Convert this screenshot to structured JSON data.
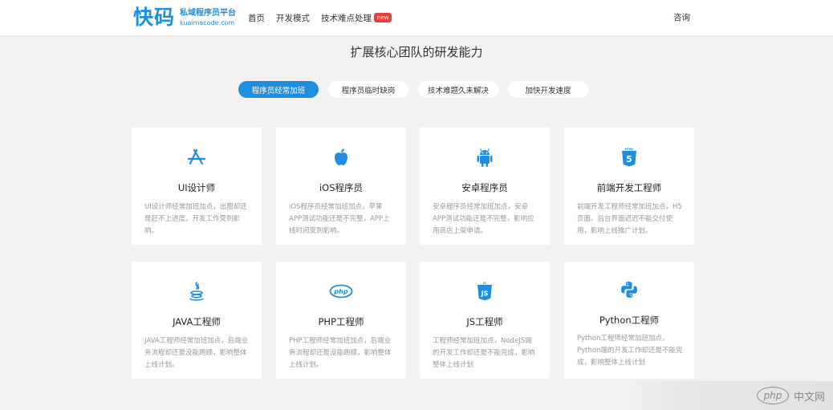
{
  "header": {
    "logo_main": "快码",
    "logo_slogan": "私域程序员平台",
    "logo_domain": "kuaimacode.com",
    "nav": [
      {
        "label": "首页"
      },
      {
        "label": "开发模式"
      },
      {
        "label": "技术难点处理",
        "badge": "new"
      }
    ],
    "consult": "咨询"
  },
  "section_title": "扩展核心团队的研发能力",
  "tabs": [
    {
      "label": "程序员经常加班",
      "active": true
    },
    {
      "label": "程序员临时缺岗",
      "active": false
    },
    {
      "label": "技术难题久未解决",
      "active": false
    },
    {
      "label": "加快开发速度",
      "active": false
    }
  ],
  "cards": [
    {
      "icon": "app-store-icon",
      "title": "UI设计师",
      "desc": "UI设计师经常加班加点，出图却还是赶不上进度，开发工作受到影响。"
    },
    {
      "icon": "apple-icon",
      "title": "iOS程序员",
      "desc": "iOS程序员经常加班加点，苹果APP测试功能还是不完整，APP上线时间受到影响。"
    },
    {
      "icon": "android-icon",
      "title": "安卓程序员",
      "desc": "安卓程序员经常加班加点，安卓APP测试功能还是不完整，影响应用商店上架申请。"
    },
    {
      "icon": "html5-icon",
      "title": "前端开发工程师",
      "desc": "前端开发工程师经常加班加点，H5页面、后台界面迟迟不能交付使用，影响上线推广计划。"
    },
    {
      "icon": "java-icon",
      "title": "JAVA工程师",
      "desc": "JAVA工程师经常加班加点，后端业务流程却还是没能跑顺，影响整体上线计划。"
    },
    {
      "icon": "php-icon",
      "title": "PHP工程师",
      "desc": "PHP工程师经常加班加点，后端业务流程却还是没能跑顺，影响整体上线计划。"
    },
    {
      "icon": "js-icon",
      "title": "JS工程师",
      "desc": "工程师经常加班加点，NodeJS端的开发工作却还是不能完成，影响整体上线计划"
    },
    {
      "icon": "python-icon",
      "title": "Python工程师",
      "desc": "Python工程师经常加班加点，Python端的开发工作却还是不能完成，影响整体上线计划"
    }
  ],
  "watermark": {
    "logo": "php",
    "text": "中文网"
  },
  "colors": {
    "accent": "#1e8fe0",
    "badge": "#e8403a",
    "background": "#f2f2f2"
  }
}
